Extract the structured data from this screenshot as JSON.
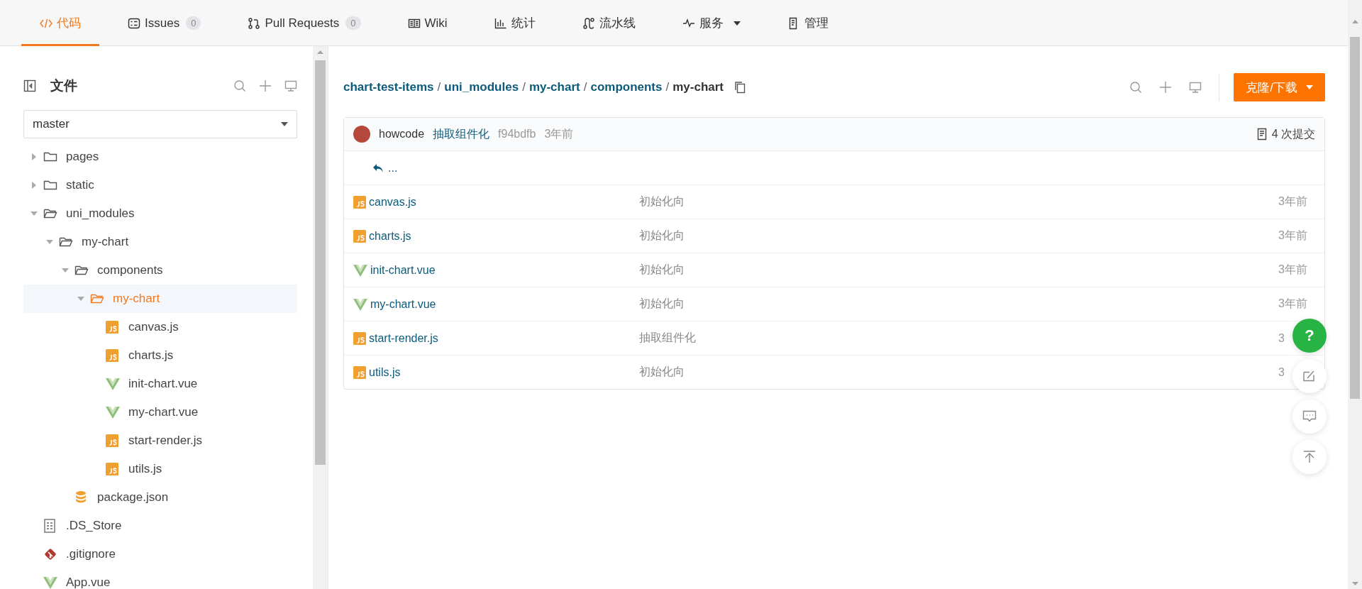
{
  "tabs": [
    {
      "kind": "code",
      "label": "代码",
      "selected": true
    },
    {
      "kind": "issues",
      "label": "Issues",
      "count": "0",
      "selected": false
    },
    {
      "kind": "pr",
      "label": "Pull Requests",
      "count": "0",
      "selected": false
    },
    {
      "kind": "wiki",
      "label": "Wiki",
      "selected": false
    },
    {
      "kind": "stats",
      "label": "统计",
      "selected": false
    },
    {
      "kind": "pipeline",
      "label": "流水线",
      "selected": false
    },
    {
      "kind": "service",
      "label": "服务",
      "dropdown": true,
      "selected": false
    },
    {
      "kind": "manage",
      "label": "管理",
      "selected": false
    }
  ],
  "sidebar": {
    "title": "文件",
    "branch": "master",
    "tree": [
      {
        "kind": "folder",
        "name": "pages",
        "expanded": false,
        "selected": false
      },
      {
        "kind": "folder",
        "name": "static",
        "expanded": false,
        "selected": false
      },
      {
        "kind": "folder",
        "name": "uni_modules",
        "expanded": true,
        "selected": false,
        "children": [
          {
            "kind": "folder",
            "name": "my-chart",
            "expanded": true,
            "selected": false,
            "children": [
              {
                "kind": "folder",
                "name": "components",
                "expanded": true,
                "selected": false,
                "children": [
                  {
                    "kind": "folder",
                    "name": "my-chart",
                    "expanded": true,
                    "selected": true,
                    "children": [
                      {
                        "kind": "js",
                        "name": "canvas.js",
                        "selected": false
                      },
                      {
                        "kind": "js",
                        "name": "charts.js",
                        "selected": false
                      },
                      {
                        "kind": "vue",
                        "name": "init-chart.vue",
                        "selected": false
                      },
                      {
                        "kind": "vue",
                        "name": "my-chart.vue",
                        "selected": false
                      },
                      {
                        "kind": "js",
                        "name": "start-render.js",
                        "selected": false
                      },
                      {
                        "kind": "js",
                        "name": "utils.js",
                        "selected": false
                      }
                    ]
                  }
                ]
              },
              {
                "kind": "json",
                "name": "package.json",
                "selected": false
              }
            ]
          }
        ]
      },
      {
        "kind": "file",
        "name": ".DS_Store",
        "selected": false
      },
      {
        "kind": "git",
        "name": ".gitignore",
        "selected": false
      },
      {
        "kind": "vue",
        "name": "App.vue",
        "selected": false
      }
    ]
  },
  "main": {
    "breadcrumb": [
      {
        "label": "chart-test-items",
        "current": false
      },
      {
        "separator": "/",
        "label": "uni_modules",
        "current": false
      },
      {
        "separator": "/",
        "label": "my-chart",
        "current": false
      },
      {
        "separator": "/",
        "label": "components",
        "current": false
      },
      {
        "separator": "/",
        "label": "my-chart",
        "current": true
      }
    ],
    "clone_button": "克隆/下载",
    "commit": {
      "author": "howcode",
      "message": "抽取组件化",
      "hash": "f94bdfb",
      "time": "3年前",
      "commits": "4 次提交"
    },
    "parent": "...",
    "files": [
      {
        "kind": "js",
        "name": "canvas.js",
        "message": "初始化向",
        "time": "3年前"
      },
      {
        "kind": "js",
        "name": "charts.js",
        "message": "初始化向",
        "time": "3年前"
      },
      {
        "kind": "vue",
        "name": "init-chart.vue",
        "message": "初始化向",
        "time": "3年前"
      },
      {
        "kind": "vue",
        "name": "my-chart.vue",
        "message": "初始化向",
        "time": "3年前"
      },
      {
        "kind": "js",
        "name": "start-render.js",
        "message": "抽取组件化",
        "time": "3"
      },
      {
        "kind": "js",
        "name": "utils.js",
        "message": "初始化向",
        "time": "3"
      }
    ]
  },
  "floating": [
    {
      "kind": "help",
      "label": "?"
    },
    {
      "kind": "edit"
    },
    {
      "kind": "comment"
    },
    {
      "kind": "top"
    }
  ]
}
